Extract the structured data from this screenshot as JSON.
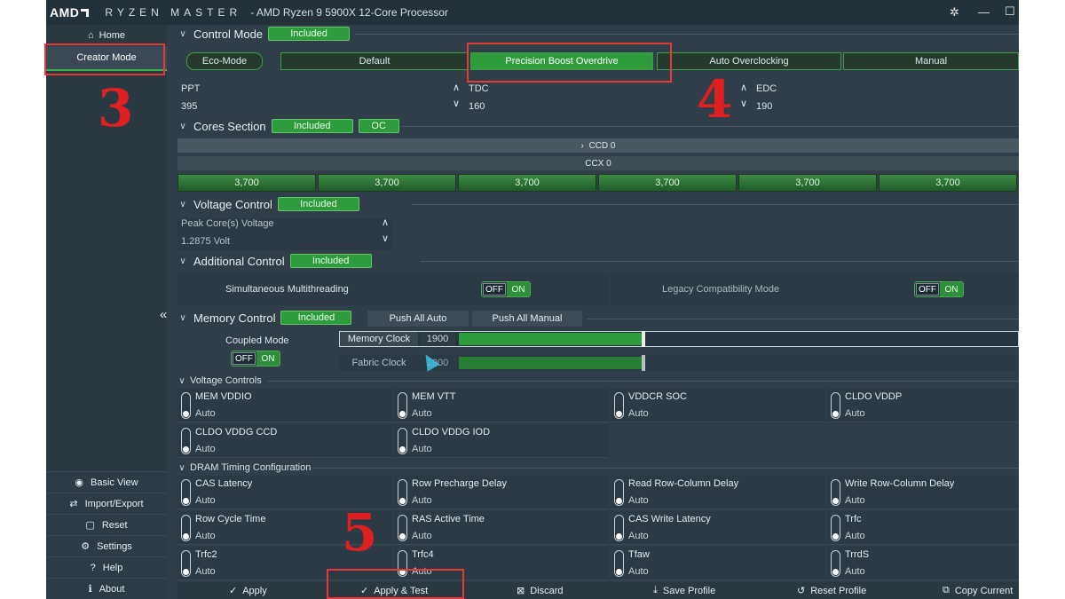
{
  "titlebar": {
    "logo": "AMD",
    "app_name": "RYZEN MASTER",
    "processor": "-  AMD Ryzen 9 5900X 12-Core Processor"
  },
  "sidebar": {
    "home": "Home",
    "creator_mode": "Creator Mode",
    "bottom": [
      "Basic View",
      "Import/Export",
      "Reset",
      "Settings",
      "Help",
      "About"
    ]
  },
  "control_mode": {
    "title": "Control Mode",
    "badge": "Included",
    "eco": "Eco-Mode",
    "modes": [
      "Default",
      "Precision Boost Overdrive",
      "Auto Overclocking",
      "Manual"
    ],
    "active_mode": "Precision Boost Overdrive",
    "ppt": {
      "label": "PPT",
      "value": "395"
    },
    "tdc": {
      "label": "TDC",
      "value": "160"
    },
    "edc": {
      "label": "EDC",
      "value": "190"
    }
  },
  "cores": {
    "title": "Cores Section",
    "badge": "Included",
    "badge2": "OC",
    "ccd": "CCD 0",
    "ccx": "CCX 0",
    "freqs": [
      "3,700",
      "3,700",
      "3,700",
      "3,700",
      "3,700",
      "3,700"
    ]
  },
  "voltage": {
    "title": "Voltage Control",
    "badge": "Included",
    "label": "Peak Core(s) Voltage",
    "value": "1.2875 Volt"
  },
  "additional": {
    "title": "Additional Control",
    "badge": "Included",
    "smt": "Simultaneous Multithreading",
    "legacy": "Legacy Compatibility Mode",
    "off": "OFF",
    "on": "ON"
  },
  "memory": {
    "title": "Memory Control",
    "badge": "Included",
    "push_auto": "Push All Auto",
    "push_manual": "Push All Manual",
    "coupled": "Coupled Mode",
    "memory_clock": {
      "label": "Memory Clock",
      "value": "1900",
      "level": 0.33
    },
    "fabric_clock": {
      "label": "Fabric Clock",
      "value": "1900",
      "level": 0.33
    }
  },
  "voltage_controls": {
    "title": "Voltage Controls",
    "items": [
      {
        "name": "MEM VDDIO",
        "value": "Auto"
      },
      {
        "name": "MEM VTT",
        "value": "Auto"
      },
      {
        "name": "VDDCR SOC",
        "value": "Auto"
      },
      {
        "name": "CLDO VDDP",
        "value": "Auto"
      },
      {
        "name": "CLDO VDDG CCD",
        "value": "Auto"
      },
      {
        "name": "CLDO VDDG IOD",
        "value": "Auto"
      }
    ]
  },
  "dram": {
    "title": "DRAM Timing Configuration",
    "items": [
      {
        "name": "CAS Latency",
        "value": "Auto"
      },
      {
        "name": "Row Precharge Delay",
        "value": "Auto"
      },
      {
        "name": "Read Row-Column Delay",
        "value": "Auto"
      },
      {
        "name": "Write Row-Column Delay",
        "value": "Auto"
      },
      {
        "name": "Row Cycle Time",
        "value": "Auto"
      },
      {
        "name": "RAS Active Time",
        "value": "Auto"
      },
      {
        "name": "CAS Write Latency",
        "value": "Auto"
      },
      {
        "name": "Trfc",
        "value": "Auto"
      },
      {
        "name": "Trfc2",
        "value": "Auto"
      },
      {
        "name": "Trfc4",
        "value": "Auto"
      },
      {
        "name": "Tfaw",
        "value": "Auto"
      },
      {
        "name": "TrrdS",
        "value": "Auto"
      }
    ]
  },
  "actions": [
    "Apply",
    "Apply & Test",
    "Discard",
    "Save Profile",
    "Reset Profile",
    "Copy Current"
  ],
  "annotations": [
    "3",
    "4",
    "5"
  ],
  "colors": {
    "accent_green": "#2f9c3b",
    "annotation_red": "#e53935",
    "panel_bg": "#2f3e49"
  }
}
